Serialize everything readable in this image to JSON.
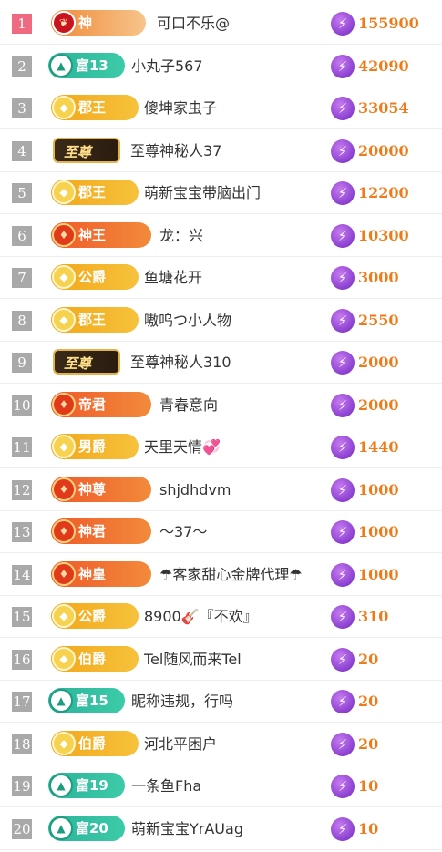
{
  "icons": {
    "coin": "lightning-coin-icon"
  },
  "colors": {
    "value": "#ef7a17",
    "rank_first": "#ef6a80",
    "rank_default": "#a9a9a9"
  },
  "rows": [
    {
      "rank": "1",
      "badge": "神",
      "badge_style": "b-god",
      "name": "可口不乐@",
      "value": "155900"
    },
    {
      "rank": "2",
      "badge": "富13",
      "badge_style": "b-teal",
      "name": "小丸子567",
      "value": "42090"
    },
    {
      "rank": "3",
      "badge": "郡王",
      "badge_style": "b-gold",
      "name": "傻坤家虫子",
      "value": "33054"
    },
    {
      "rank": "4",
      "badge": "至尊",
      "badge_style": "b-dark",
      "name": "至尊神秘人37",
      "value": "20000"
    },
    {
      "rank": "5",
      "badge": "郡王",
      "badge_style": "b-gold",
      "name": "萌新宝宝带脑出门",
      "value": "12200"
    },
    {
      "rank": "6",
      "badge": "神王",
      "badge_style": "b-red",
      "name": "龙：兴",
      "value": "10300"
    },
    {
      "rank": "7",
      "badge": "公爵",
      "badge_style": "b-gold",
      "name": "鱼塘花开",
      "value": "3000"
    },
    {
      "rank": "8",
      "badge": "郡王",
      "badge_style": "b-gold",
      "name": "嗷呜つ小人物",
      "value": "2550"
    },
    {
      "rank": "9",
      "badge": "至尊",
      "badge_style": "b-dark",
      "name": "至尊神秘人310",
      "value": "2000"
    },
    {
      "rank": "10",
      "badge": "帝君",
      "badge_style": "b-red",
      "name": "青春意向",
      "value": "2000"
    },
    {
      "rank": "11",
      "badge": "男爵",
      "badge_style": "b-gold",
      "name": "天里天情💞",
      "value": "1440"
    },
    {
      "rank": "12",
      "badge": "神尊",
      "badge_style": "b-red",
      "name": "shjdhdvm",
      "value": "1000"
    },
    {
      "rank": "13",
      "badge": "神君",
      "badge_style": "b-red",
      "name": "～37～",
      "value": "1000"
    },
    {
      "rank": "14",
      "badge": "神皇",
      "badge_style": "b-red",
      "name": "☂客家甜心金牌代理☂",
      "value": "1000"
    },
    {
      "rank": "15",
      "badge": "公爵",
      "badge_style": "b-gold",
      "name": "8900🎸『不欢』",
      "value": "310"
    },
    {
      "rank": "16",
      "badge": "伯爵",
      "badge_style": "b-gold",
      "name": "Tel随风而来Tel",
      "value": "20"
    },
    {
      "rank": "17",
      "badge": "富15",
      "badge_style": "b-teal",
      "name": "昵称违规，行吗",
      "value": "20"
    },
    {
      "rank": "18",
      "badge": "伯爵",
      "badge_style": "b-gold",
      "name": "河北平困户",
      "value": "20"
    },
    {
      "rank": "19",
      "badge": "富19",
      "badge_style": "b-teal",
      "name": "一条鱼Fha",
      "value": "10"
    },
    {
      "rank": "20",
      "badge": "富20",
      "badge_style": "b-teal",
      "name": "萌新宝宝YrAUag",
      "value": "10"
    }
  ]
}
